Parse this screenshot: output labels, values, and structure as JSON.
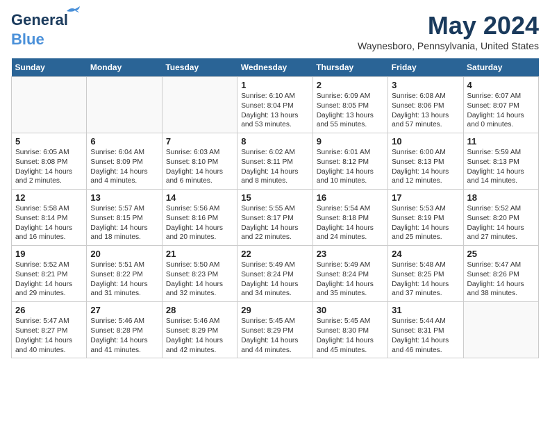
{
  "header": {
    "logo_line1": "General",
    "logo_line2": "Blue",
    "month_title": "May 2024",
    "location": "Waynesboro, Pennsylvania, United States"
  },
  "days_of_week": [
    "Sunday",
    "Monday",
    "Tuesday",
    "Wednesday",
    "Thursday",
    "Friday",
    "Saturday"
  ],
  "weeks": [
    [
      {
        "day": "",
        "text": ""
      },
      {
        "day": "",
        "text": ""
      },
      {
        "day": "",
        "text": ""
      },
      {
        "day": "1",
        "text": "Sunrise: 6:10 AM\nSunset: 8:04 PM\nDaylight: 13 hours\nand 53 minutes."
      },
      {
        "day": "2",
        "text": "Sunrise: 6:09 AM\nSunset: 8:05 PM\nDaylight: 13 hours\nand 55 minutes."
      },
      {
        "day": "3",
        "text": "Sunrise: 6:08 AM\nSunset: 8:06 PM\nDaylight: 13 hours\nand 57 minutes."
      },
      {
        "day": "4",
        "text": "Sunrise: 6:07 AM\nSunset: 8:07 PM\nDaylight: 14 hours\nand 0 minutes."
      }
    ],
    [
      {
        "day": "5",
        "text": "Sunrise: 6:05 AM\nSunset: 8:08 PM\nDaylight: 14 hours\nand 2 minutes."
      },
      {
        "day": "6",
        "text": "Sunrise: 6:04 AM\nSunset: 8:09 PM\nDaylight: 14 hours\nand 4 minutes."
      },
      {
        "day": "7",
        "text": "Sunrise: 6:03 AM\nSunset: 8:10 PM\nDaylight: 14 hours\nand 6 minutes."
      },
      {
        "day": "8",
        "text": "Sunrise: 6:02 AM\nSunset: 8:11 PM\nDaylight: 14 hours\nand 8 minutes."
      },
      {
        "day": "9",
        "text": "Sunrise: 6:01 AM\nSunset: 8:12 PM\nDaylight: 14 hours\nand 10 minutes."
      },
      {
        "day": "10",
        "text": "Sunrise: 6:00 AM\nSunset: 8:13 PM\nDaylight: 14 hours\nand 12 minutes."
      },
      {
        "day": "11",
        "text": "Sunrise: 5:59 AM\nSunset: 8:13 PM\nDaylight: 14 hours\nand 14 minutes."
      }
    ],
    [
      {
        "day": "12",
        "text": "Sunrise: 5:58 AM\nSunset: 8:14 PM\nDaylight: 14 hours\nand 16 minutes."
      },
      {
        "day": "13",
        "text": "Sunrise: 5:57 AM\nSunset: 8:15 PM\nDaylight: 14 hours\nand 18 minutes."
      },
      {
        "day": "14",
        "text": "Sunrise: 5:56 AM\nSunset: 8:16 PM\nDaylight: 14 hours\nand 20 minutes."
      },
      {
        "day": "15",
        "text": "Sunrise: 5:55 AM\nSunset: 8:17 PM\nDaylight: 14 hours\nand 22 minutes."
      },
      {
        "day": "16",
        "text": "Sunrise: 5:54 AM\nSunset: 8:18 PM\nDaylight: 14 hours\nand 24 minutes."
      },
      {
        "day": "17",
        "text": "Sunrise: 5:53 AM\nSunset: 8:19 PM\nDaylight: 14 hours\nand 25 minutes."
      },
      {
        "day": "18",
        "text": "Sunrise: 5:52 AM\nSunset: 8:20 PM\nDaylight: 14 hours\nand 27 minutes."
      }
    ],
    [
      {
        "day": "19",
        "text": "Sunrise: 5:52 AM\nSunset: 8:21 PM\nDaylight: 14 hours\nand 29 minutes."
      },
      {
        "day": "20",
        "text": "Sunrise: 5:51 AM\nSunset: 8:22 PM\nDaylight: 14 hours\nand 31 minutes."
      },
      {
        "day": "21",
        "text": "Sunrise: 5:50 AM\nSunset: 8:23 PM\nDaylight: 14 hours\nand 32 minutes."
      },
      {
        "day": "22",
        "text": "Sunrise: 5:49 AM\nSunset: 8:24 PM\nDaylight: 14 hours\nand 34 minutes."
      },
      {
        "day": "23",
        "text": "Sunrise: 5:49 AM\nSunset: 8:24 PM\nDaylight: 14 hours\nand 35 minutes."
      },
      {
        "day": "24",
        "text": "Sunrise: 5:48 AM\nSunset: 8:25 PM\nDaylight: 14 hours\nand 37 minutes."
      },
      {
        "day": "25",
        "text": "Sunrise: 5:47 AM\nSunset: 8:26 PM\nDaylight: 14 hours\nand 38 minutes."
      }
    ],
    [
      {
        "day": "26",
        "text": "Sunrise: 5:47 AM\nSunset: 8:27 PM\nDaylight: 14 hours\nand 40 minutes."
      },
      {
        "day": "27",
        "text": "Sunrise: 5:46 AM\nSunset: 8:28 PM\nDaylight: 14 hours\nand 41 minutes."
      },
      {
        "day": "28",
        "text": "Sunrise: 5:46 AM\nSunset: 8:29 PM\nDaylight: 14 hours\nand 42 minutes."
      },
      {
        "day": "29",
        "text": "Sunrise: 5:45 AM\nSunset: 8:29 PM\nDaylight: 14 hours\nand 44 minutes."
      },
      {
        "day": "30",
        "text": "Sunrise: 5:45 AM\nSunset: 8:30 PM\nDaylight: 14 hours\nand 45 minutes."
      },
      {
        "day": "31",
        "text": "Sunrise: 5:44 AM\nSunset: 8:31 PM\nDaylight: 14 hours\nand 46 minutes."
      },
      {
        "day": "",
        "text": ""
      }
    ]
  ]
}
